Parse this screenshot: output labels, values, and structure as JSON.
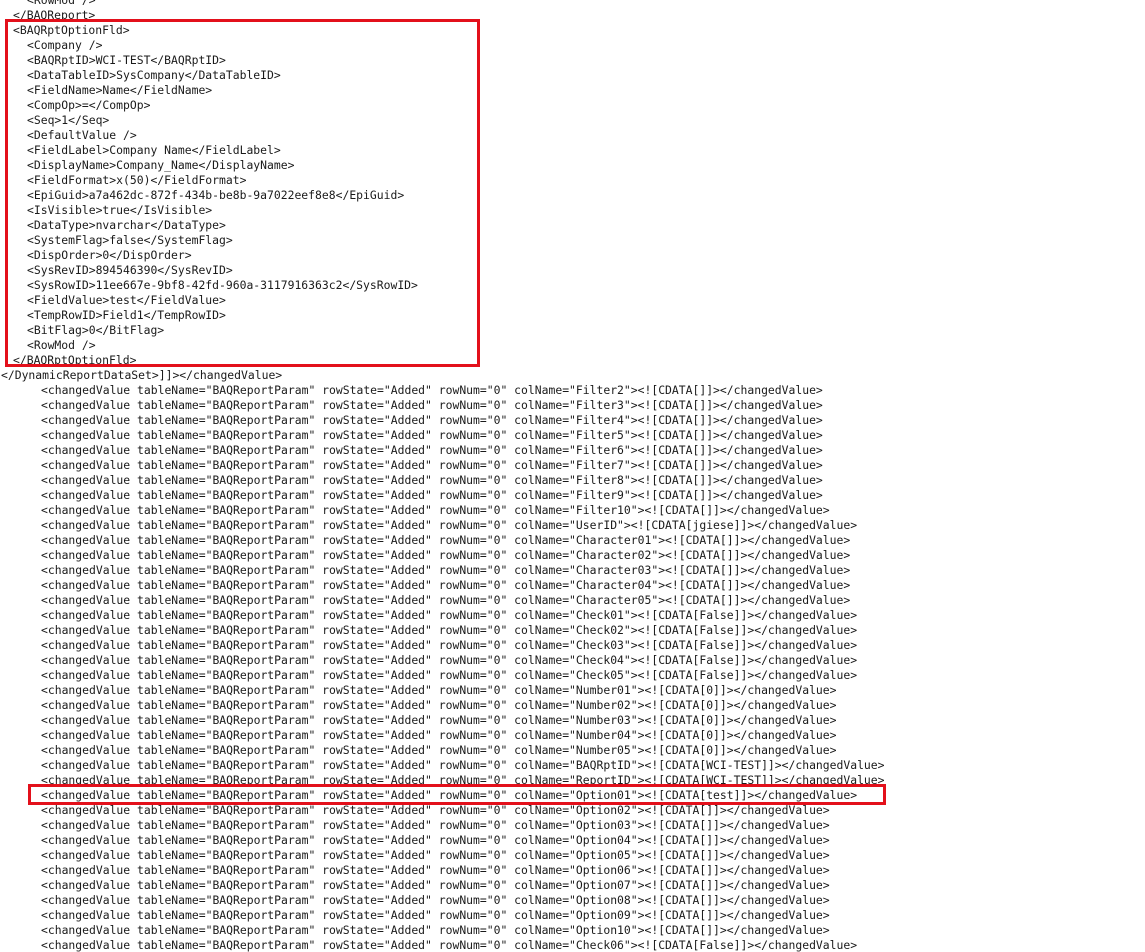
{
  "document": {
    "lines": [
      {
        "indent": 2,
        "text": "<RowMod />"
      },
      {
        "indent": 1,
        "text": "</BAQReport>"
      },
      {
        "indent": 1,
        "text": "<BAQRptOptionFld>"
      },
      {
        "indent": 2,
        "text": "<Company />"
      },
      {
        "indent": 2,
        "text": "<BAQRptID>WCI-TEST</BAQRptID>"
      },
      {
        "indent": 2,
        "text": "<DataTableID>SysCompany</DataTableID>"
      },
      {
        "indent": 2,
        "text": "<FieldName>Name</FieldName>"
      },
      {
        "indent": 2,
        "text": "<CompOp>=</CompOp>"
      },
      {
        "indent": 2,
        "text": "<Seq>1</Seq>"
      },
      {
        "indent": 2,
        "text": "<DefaultValue />"
      },
      {
        "indent": 2,
        "text": "<FieldLabel>Company Name</FieldLabel>"
      },
      {
        "indent": 2,
        "text": "<DisplayName>Company_Name</DisplayName>"
      },
      {
        "indent": 2,
        "text": "<FieldFormat>x(50)</FieldFormat>"
      },
      {
        "indent": 2,
        "text": "<EpiGuid>a7a462dc-872f-434b-be8b-9a7022eef8e8</EpiGuid>"
      },
      {
        "indent": 2,
        "text": "<IsVisible>true</IsVisible>"
      },
      {
        "indent": 2,
        "text": "<DataType>nvarchar</DataType>"
      },
      {
        "indent": 2,
        "text": "<SystemFlag>false</SystemFlag>"
      },
      {
        "indent": 2,
        "text": "<DispOrder>0</DispOrder>"
      },
      {
        "indent": 2,
        "text": "<SysRevID>894546390</SysRevID>"
      },
      {
        "indent": 2,
        "text": "<SysRowID>11ee667e-9bf8-42fd-960a-3117916363c2</SysRowID>"
      },
      {
        "indent": 2,
        "text": "<FieldValue>test</FieldValue>"
      },
      {
        "indent": 2,
        "text": "<TempRowID>Field1</TempRowID>"
      },
      {
        "indent": 2,
        "text": "<BitFlag>0</BitFlag>"
      },
      {
        "indent": 2,
        "text": "<RowMod />"
      },
      {
        "indent": 1,
        "text": "</BAQRptOptionFld>"
      },
      {
        "indent": 0,
        "text": "</DynamicReportDataSet>]]></changedValue>"
      },
      {
        "indent": 3,
        "text": "<changedValue tableName=\"BAQReportParam\" rowState=\"Added\" rowNum=\"0\" colName=\"Filter2\"><![CDATA[]]></changedValue>"
      },
      {
        "indent": 3,
        "text": "<changedValue tableName=\"BAQReportParam\" rowState=\"Added\" rowNum=\"0\" colName=\"Filter3\"><![CDATA[]]></changedValue>"
      },
      {
        "indent": 3,
        "text": "<changedValue tableName=\"BAQReportParam\" rowState=\"Added\" rowNum=\"0\" colName=\"Filter4\"><![CDATA[]]></changedValue>"
      },
      {
        "indent": 3,
        "text": "<changedValue tableName=\"BAQReportParam\" rowState=\"Added\" rowNum=\"0\" colName=\"Filter5\"><![CDATA[]]></changedValue>"
      },
      {
        "indent": 3,
        "text": "<changedValue tableName=\"BAQReportParam\" rowState=\"Added\" rowNum=\"0\" colName=\"Filter6\"><![CDATA[]]></changedValue>"
      },
      {
        "indent": 3,
        "text": "<changedValue tableName=\"BAQReportParam\" rowState=\"Added\" rowNum=\"0\" colName=\"Filter7\"><![CDATA[]]></changedValue>"
      },
      {
        "indent": 3,
        "text": "<changedValue tableName=\"BAQReportParam\" rowState=\"Added\" rowNum=\"0\" colName=\"Filter8\"><![CDATA[]]></changedValue>"
      },
      {
        "indent": 3,
        "text": "<changedValue tableName=\"BAQReportParam\" rowState=\"Added\" rowNum=\"0\" colName=\"Filter9\"><![CDATA[]]></changedValue>"
      },
      {
        "indent": 3,
        "text": "<changedValue tableName=\"BAQReportParam\" rowState=\"Added\" rowNum=\"0\" colName=\"Filter10\"><![CDATA[]]></changedValue>"
      },
      {
        "indent": 3,
        "text": "<changedValue tableName=\"BAQReportParam\" rowState=\"Added\" rowNum=\"0\" colName=\"UserID\"><![CDATA[jgiese]]></changedValue>"
      },
      {
        "indent": 3,
        "text": "<changedValue tableName=\"BAQReportParam\" rowState=\"Added\" rowNum=\"0\" colName=\"Character01\"><![CDATA[]]></changedValue>"
      },
      {
        "indent": 3,
        "text": "<changedValue tableName=\"BAQReportParam\" rowState=\"Added\" rowNum=\"0\" colName=\"Character02\"><![CDATA[]]></changedValue>"
      },
      {
        "indent": 3,
        "text": "<changedValue tableName=\"BAQReportParam\" rowState=\"Added\" rowNum=\"0\" colName=\"Character03\"><![CDATA[]]></changedValue>"
      },
      {
        "indent": 3,
        "text": "<changedValue tableName=\"BAQReportParam\" rowState=\"Added\" rowNum=\"0\" colName=\"Character04\"><![CDATA[]]></changedValue>"
      },
      {
        "indent": 3,
        "text": "<changedValue tableName=\"BAQReportParam\" rowState=\"Added\" rowNum=\"0\" colName=\"Character05\"><![CDATA[]]></changedValue>"
      },
      {
        "indent": 3,
        "text": "<changedValue tableName=\"BAQReportParam\" rowState=\"Added\" rowNum=\"0\" colName=\"Check01\"><![CDATA[False]]></changedValue>"
      },
      {
        "indent": 3,
        "text": "<changedValue tableName=\"BAQReportParam\" rowState=\"Added\" rowNum=\"0\" colName=\"Check02\"><![CDATA[False]]></changedValue>"
      },
      {
        "indent": 3,
        "text": "<changedValue tableName=\"BAQReportParam\" rowState=\"Added\" rowNum=\"0\" colName=\"Check03\"><![CDATA[False]]></changedValue>"
      },
      {
        "indent": 3,
        "text": "<changedValue tableName=\"BAQReportParam\" rowState=\"Added\" rowNum=\"0\" colName=\"Check04\"><![CDATA[False]]></changedValue>"
      },
      {
        "indent": 3,
        "text": "<changedValue tableName=\"BAQReportParam\" rowState=\"Added\" rowNum=\"0\" colName=\"Check05\"><![CDATA[False]]></changedValue>"
      },
      {
        "indent": 3,
        "text": "<changedValue tableName=\"BAQReportParam\" rowState=\"Added\" rowNum=\"0\" colName=\"Number01\"><![CDATA[0]]></changedValue>"
      },
      {
        "indent": 3,
        "text": "<changedValue tableName=\"BAQReportParam\" rowState=\"Added\" rowNum=\"0\" colName=\"Number02\"><![CDATA[0]]></changedValue>"
      },
      {
        "indent": 3,
        "text": "<changedValue tableName=\"BAQReportParam\" rowState=\"Added\" rowNum=\"0\" colName=\"Number03\"><![CDATA[0]]></changedValue>"
      },
      {
        "indent": 3,
        "text": "<changedValue tableName=\"BAQReportParam\" rowState=\"Added\" rowNum=\"0\" colName=\"Number04\"><![CDATA[0]]></changedValue>"
      },
      {
        "indent": 3,
        "text": "<changedValue tableName=\"BAQReportParam\" rowState=\"Added\" rowNum=\"0\" colName=\"Number05\"><![CDATA[0]]></changedValue>"
      },
      {
        "indent": 3,
        "text": "<changedValue tableName=\"BAQReportParam\" rowState=\"Added\" rowNum=\"0\" colName=\"BAQRptID\"><![CDATA[WCI-TEST]]></changedValue>"
      },
      {
        "indent": 3,
        "text": "<changedValue tableName=\"BAQReportParam\" rowState=\"Added\" rowNum=\"0\" colName=\"ReportID\"><![CDATA[WCI-TEST]]></changedValue>"
      },
      {
        "indent": 3,
        "text": "<changedValue tableName=\"BAQReportParam\" rowState=\"Added\" rowNum=\"0\" colName=\"Option01\"><![CDATA[test]]></changedValue>"
      },
      {
        "indent": 3,
        "text": "<changedValue tableName=\"BAQReportParam\" rowState=\"Added\" rowNum=\"0\" colName=\"Option02\"><![CDATA[]]></changedValue>"
      },
      {
        "indent": 3,
        "text": "<changedValue tableName=\"BAQReportParam\" rowState=\"Added\" rowNum=\"0\" colName=\"Option03\"><![CDATA[]]></changedValue>"
      },
      {
        "indent": 3,
        "text": "<changedValue tableName=\"BAQReportParam\" rowState=\"Added\" rowNum=\"0\" colName=\"Option04\"><![CDATA[]]></changedValue>"
      },
      {
        "indent": 3,
        "text": "<changedValue tableName=\"BAQReportParam\" rowState=\"Added\" rowNum=\"0\" colName=\"Option05\"><![CDATA[]]></changedValue>"
      },
      {
        "indent": 3,
        "text": "<changedValue tableName=\"BAQReportParam\" rowState=\"Added\" rowNum=\"0\" colName=\"Option06\"><![CDATA[]]></changedValue>"
      },
      {
        "indent": 3,
        "text": "<changedValue tableName=\"BAQReportParam\" rowState=\"Added\" rowNum=\"0\" colName=\"Option07\"><![CDATA[]]></changedValue>"
      },
      {
        "indent": 3,
        "text": "<changedValue tableName=\"BAQReportParam\" rowState=\"Added\" rowNum=\"0\" colName=\"Option08\"><![CDATA[]]></changedValue>"
      },
      {
        "indent": 3,
        "text": "<changedValue tableName=\"BAQReportParam\" rowState=\"Added\" rowNum=\"0\" colName=\"Option09\"><![CDATA[]]></changedValue>"
      },
      {
        "indent": 3,
        "text": "<changedValue tableName=\"BAQReportParam\" rowState=\"Added\" rowNum=\"0\" colName=\"Option10\"><![CDATA[]]></changedValue>"
      },
      {
        "indent": 3,
        "text": "<changedValue tableName=\"BAQReportParam\" rowState=\"Added\" rowNum=\"0\" colName=\"Check06\"><![CDATA[False]]></changedValue>"
      }
    ]
  },
  "highlights": {
    "color": "#e3101b"
  }
}
